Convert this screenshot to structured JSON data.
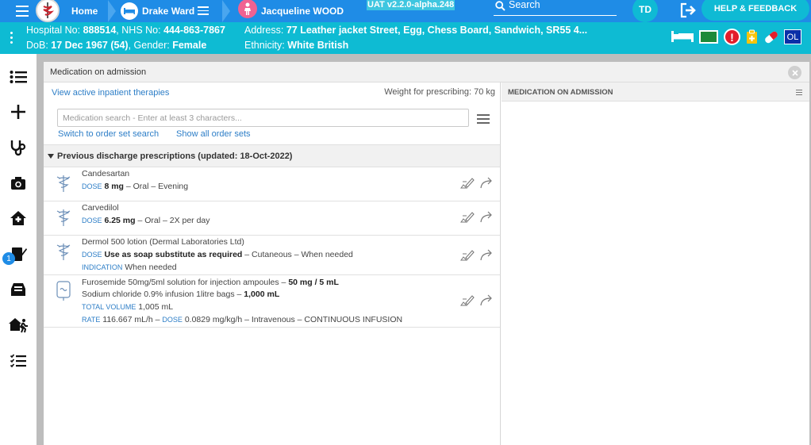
{
  "topbar": {
    "home": "Home",
    "ward": "Drake Ward",
    "patient": "Jacqueline WOOD",
    "version": "UAT v2.2.0-alpha.248",
    "search_placeholder": "Search",
    "user_initials": "TD",
    "help": "HELP & FEEDBACK"
  },
  "patient_banner": {
    "hospital_no_label": "Hospital No:",
    "hospital_no": "888514",
    "nhs_label": "NHS No:",
    "nhs_no": "444-863-7867",
    "address_label": "Address:",
    "address": "77 Leather jacket Street, Egg, Chess Board, Sandwich, SR55 4...",
    "dob_label": "DoB:",
    "dob": "17 Dec 1967 (54)",
    "gender_label": "Gender:",
    "gender": "Female",
    "ethnicity_label": "Ethnicity:",
    "ethnicity": "White British",
    "ol_badge": "OL"
  },
  "sidebar": {
    "badge_count": "1"
  },
  "dialog": {
    "title": "Medication on admission",
    "view_link": "View active inpatient therapies",
    "weight_label": "Weight for prescribing: 70 kg",
    "search_placeholder": "Medication search - Enter at least 3 characters...",
    "switch_link": "Switch to order set search",
    "show_all_link": "Show all order sets",
    "section_header": "Previous discharge prescriptions (updated: 18-Oct-2022)",
    "right_header": "MEDICATION ON ADMISSION"
  },
  "labels": {
    "dose": "DOSE",
    "indication": "INDICATION",
    "total_volume": "TOTAL VOLUME",
    "rate": "RATE"
  },
  "meds": [
    {
      "name": "Candesartan",
      "dose": "8 mg",
      "rest": "– Oral – Evening"
    },
    {
      "name": "Carvedilol",
      "dose": "6.25 mg",
      "rest": "– Oral – 2X per day"
    },
    {
      "name": "Dermol 500 lotion (Dermal Laboratories Ltd)",
      "dose": "Use as soap substitute as required",
      "rest": "– Cutaneous – When needed",
      "indication": "When needed"
    }
  ],
  "infusion": {
    "line1_text": "Furosemide 50mg/5ml solution for injection ampoules –",
    "line1_bold": "50 mg / 5 mL",
    "line2_text": "Sodium chloride 0.9% infusion 1litre bags –",
    "line2_bold": "1,000 mL",
    "total_volume": "1,005 mL",
    "rate": "116.667 mL/h –",
    "dose": "0.0829 mg/kg/h – Intravenous – CONTINUOUS INFUSION"
  }
}
